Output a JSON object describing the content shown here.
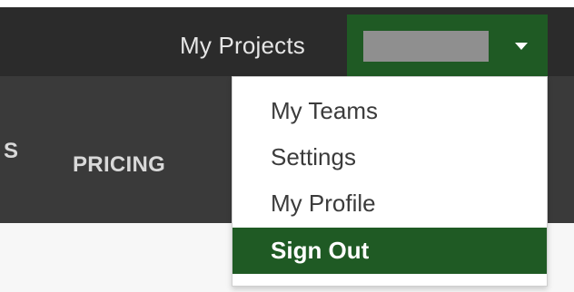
{
  "header": {
    "nav_link": "My Projects",
    "user_menu": {
      "username": "",
      "caret_icon": "caret-down-icon"
    }
  },
  "subnav": {
    "partial_item": "S",
    "pricing": "PRICING"
  },
  "dropdown": {
    "items": [
      {
        "label": "My Teams"
      },
      {
        "label": "Settings"
      },
      {
        "label": "My Profile"
      },
      {
        "label": "Sign Out",
        "highlighted": true
      }
    ]
  },
  "colors": {
    "topbar": "#2b2b2b",
    "subnav": "#3a3a3a",
    "accent_green": "#1f5a24",
    "dropdown_bg": "#ffffff"
  }
}
